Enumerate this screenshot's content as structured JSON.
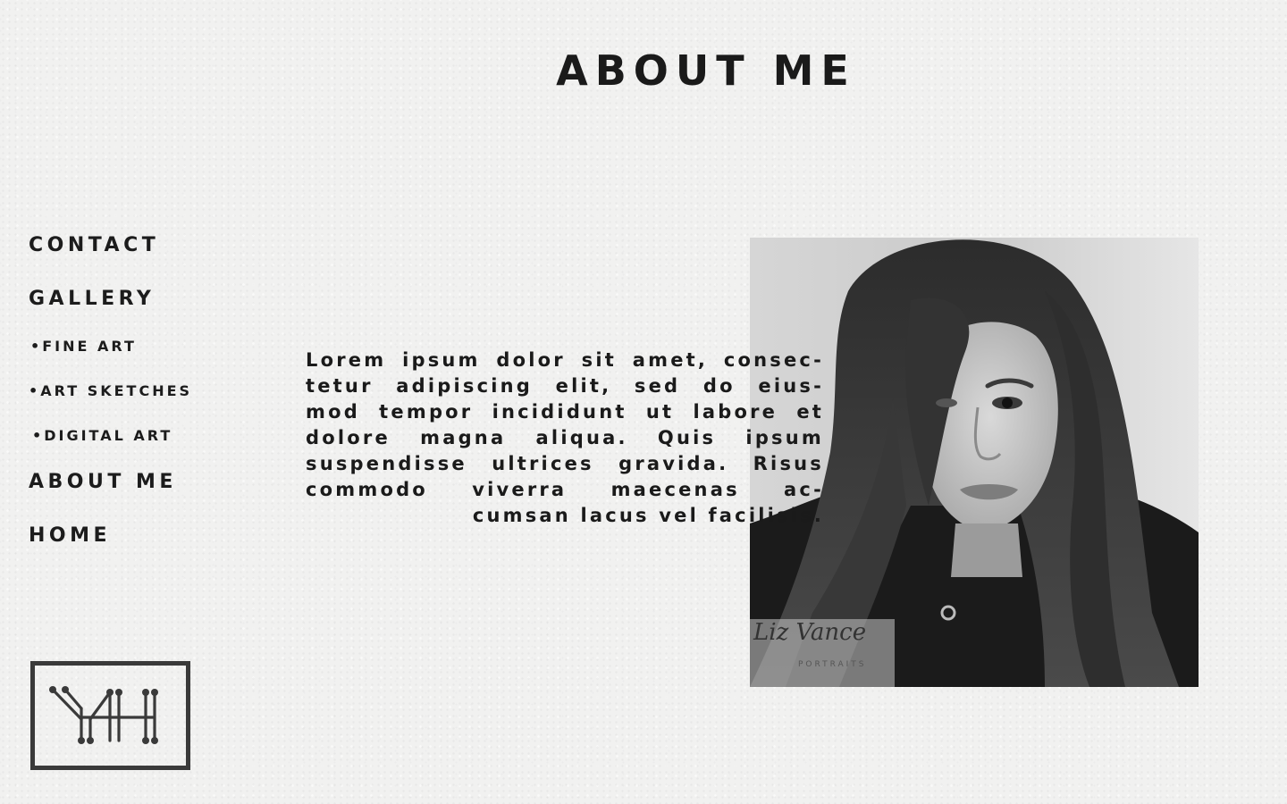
{
  "header": {
    "title": "ABOUT ME"
  },
  "sidebar": {
    "items": [
      {
        "label": "CONTACT",
        "level": "main"
      },
      {
        "label": "GALLERY",
        "level": "main"
      },
      {
        "label": "•FINE ART",
        "level": "sub"
      },
      {
        "label": "•ART SKETCHES",
        "level": "sub"
      },
      {
        "label": "•DIGITAL ART",
        "level": "sub"
      },
      {
        "label": "ABOUT ME",
        "level": "main"
      },
      {
        "label": "HOME",
        "level": "main"
      }
    ]
  },
  "bio": {
    "lines": [
      "Lorem ipsum dolor sit amet, consec-",
      "tetur adipiscing elit, sed do eius-",
      "mod tempor incididunt ut labore et",
      "dolore magna aliqua. Quis ipsum",
      "suspendisse ultrices gravida. Risus",
      "commodo viverra maecenas ac-",
      "cumsan lacus vel facilisis."
    ]
  },
  "portrait": {
    "watermark_name": "Liz Vance",
    "watermark_sub": "PORTRAITS"
  },
  "logo": {
    "mark": "YH"
  },
  "colors": {
    "background": "#f1f1f0",
    "text": "#1c1c1c",
    "logo_border": "#3a3a3a"
  }
}
